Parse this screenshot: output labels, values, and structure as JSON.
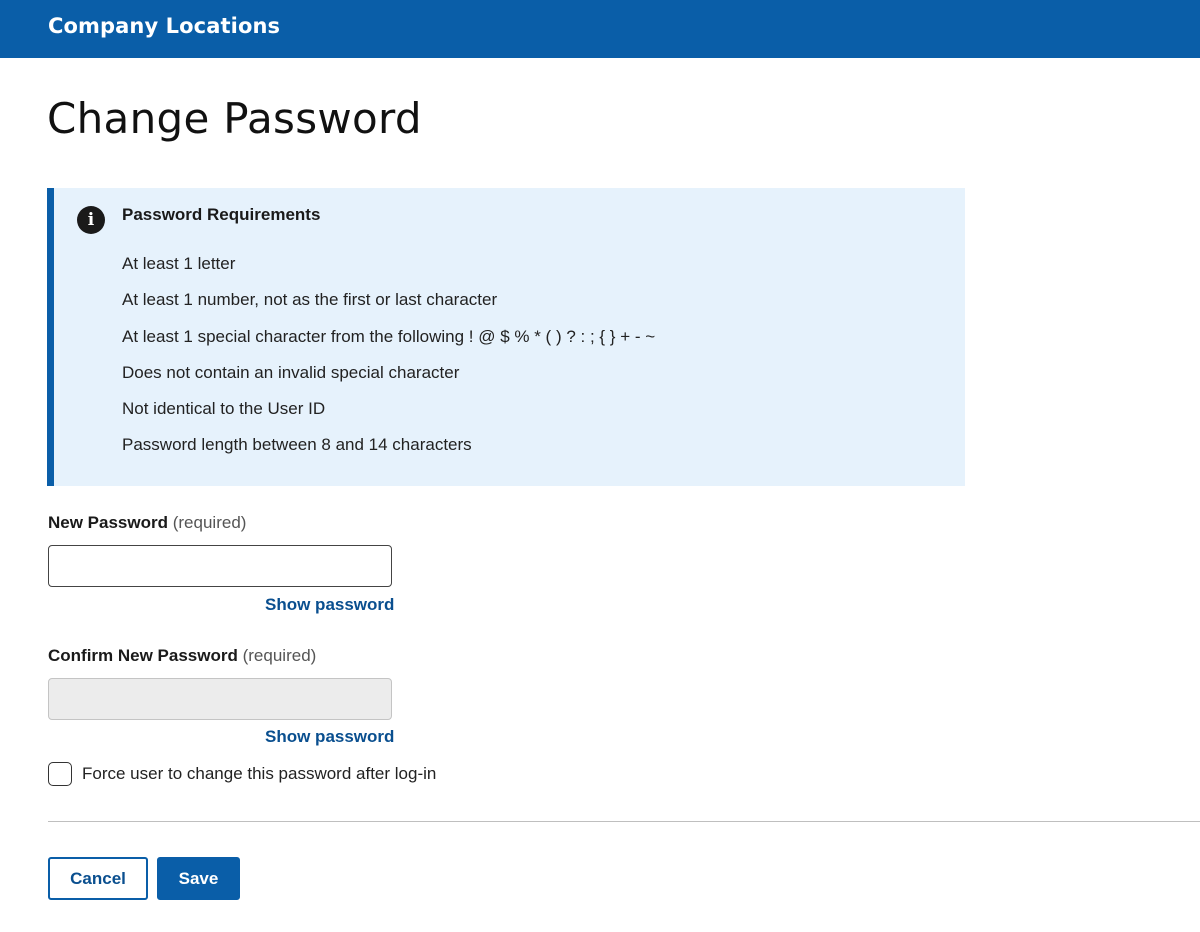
{
  "header": {
    "brand": "Company Locations"
  },
  "page": {
    "title": "Change Password"
  },
  "requirements": {
    "title": "Password Requirements",
    "icon": "info-icon",
    "items": [
      "At least 1 letter",
      "At least 1 number, not as the first or last character",
      "At least 1 special character from the following ! @ $ % * ( ) ? : ; { } + - ~",
      "Does not contain an invalid special character",
      "Not identical to the User ID",
      "Password length between 8 and 14 characters"
    ]
  },
  "form": {
    "new_password": {
      "label": "New Password",
      "required": "(required)",
      "value": "",
      "show_label": "Show password"
    },
    "confirm_password": {
      "label": "Confirm New Password",
      "required": "(required)",
      "value": "",
      "disabled": true,
      "show_label": "Show password"
    },
    "force_change": {
      "label": "Force user to change this password after log-in",
      "checked": false
    }
  },
  "actions": {
    "cancel_label": "Cancel",
    "save_label": "Save"
  },
  "colors": {
    "brand_blue": "#0a5ea8",
    "info_bg": "#e6f2fc",
    "link": "#0a4f8f"
  }
}
